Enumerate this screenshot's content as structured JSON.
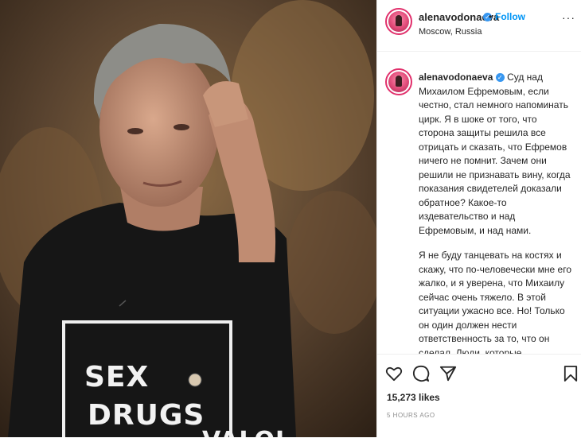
{
  "post": {
    "username": "alenavodonaeva",
    "follow_label": "Follow",
    "separator": "•",
    "location": "Moscow, Russia",
    "more_label": "···",
    "caption_username": "alenavodonaeva",
    "caption_paragraph_1": "Суд над Михаилом Ефремовым, если честно, стал немного напоминать цирк. Я в шоке от того, что сторона защиты решила все отрицать и сказать, что Ефремов ничего не помнит. Зачем они решили не признавать вину, когда показания свидетелей доказали обратное? Какое-то издевательство и над Ефремовым, и над нами.",
    "caption_paragraph_2": "Я не буду танцевать на костях и скажу, что по-человечески мне его жалко, и я уверена, что Михаилу сейчас очень тяжело. В этой ситуации ужасно все. Но! Только он один должен нести ответственность за то, что он сделал. Люди, которые собираются сесть за руль,",
    "likes": "15,273 likes",
    "time_ago": "5 HOURS AGO"
  },
  "photo": {
    "shirt_line_1": "SEX",
    "shirt_line_2": "DRUGS",
    "shirt_line_3": "VALOL"
  },
  "icons": {
    "like": "heart-icon",
    "comment": "comment-icon",
    "share": "share-icon",
    "save": "bookmark-icon",
    "verified": "verified-badge-icon"
  },
  "colors": {
    "follow_blue": "#0095f6",
    "verified_blue": "#3897f0",
    "muted_text": "#8e8e8e",
    "avatar_ring": "#e1306c"
  }
}
